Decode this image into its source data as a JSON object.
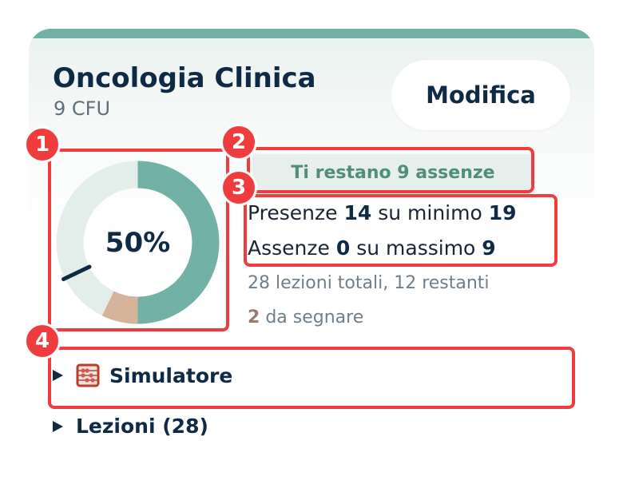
{
  "course": {
    "title": "Oncologia Clinica",
    "credits": "9 CFU",
    "edit_label": "Modifica"
  },
  "attendance": {
    "percent_label": "50%",
    "percent_value": 50,
    "remaining_absences_label": "Ti restano 9 assenze",
    "presence_prefix": "Presenze",
    "presence_count": "14",
    "presence_mid": "su minimo",
    "presence_min": "19",
    "absence_prefix": "Assenze",
    "absence_count": "0",
    "absence_mid": "su massimo",
    "absence_max": "9",
    "lessons_summary": "28 lezioni totali, 12 restanti",
    "pending_count": "2",
    "pending_suffix": "da segnare"
  },
  "sections": {
    "simulator_label": "Simulatore",
    "lessons_label": "Lezioni (28)"
  },
  "annotations": [
    "1",
    "2",
    "3",
    "4"
  ],
  "colors": {
    "accent": "#71b1a6",
    "present_arc": "#71b1a6",
    "pending_arc": "#d4b39a",
    "track": "#e3eeeb",
    "text_dark": "#0f2a44",
    "pill_text": "#4f8f79",
    "annotation": "#f03c3c"
  }
}
